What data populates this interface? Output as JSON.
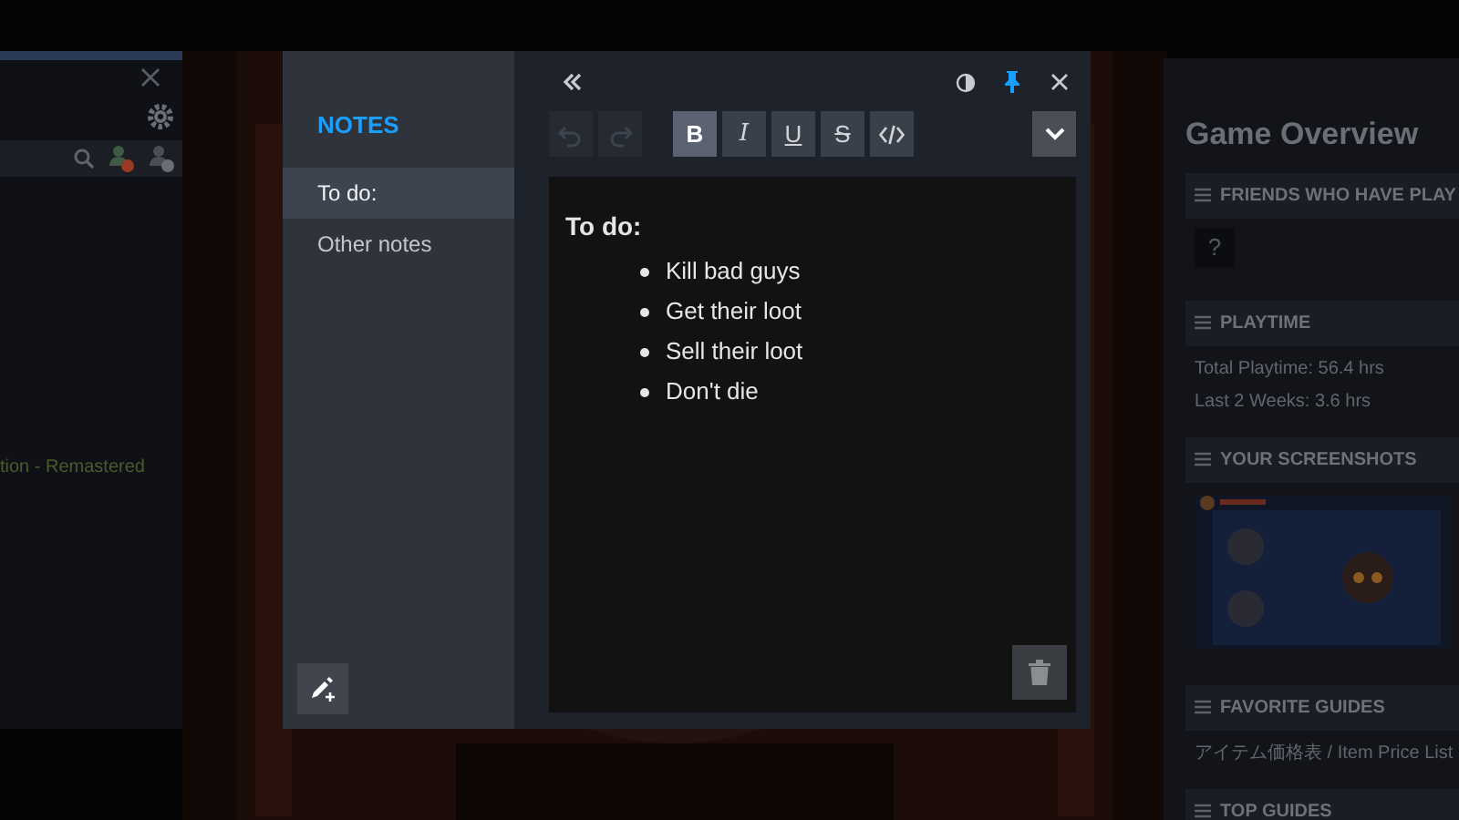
{
  "friends_panel": {
    "game_status": "tion - Remastered"
  },
  "notes": {
    "title": "NOTES",
    "items": [
      {
        "label": "To do:",
        "selected": true
      },
      {
        "label": "Other notes",
        "selected": false
      }
    ],
    "toolbar": [
      {
        "kind": "undo",
        "disabled": true
      },
      {
        "kind": "redo",
        "disabled": true
      },
      {
        "kind": "bold",
        "active": true,
        "label": "B"
      },
      {
        "kind": "italic",
        "active": false,
        "label": "I"
      },
      {
        "kind": "underline",
        "active": false,
        "label": "U"
      },
      {
        "kind": "strike",
        "active": false,
        "label": "S"
      },
      {
        "kind": "code",
        "active": false
      }
    ],
    "document": {
      "heading": "To do:",
      "bullets": [
        "Kill bad guys",
        "Get their loot",
        "Sell their loot",
        "Don't die"
      ]
    }
  },
  "game_overview": {
    "title": "Game Overview",
    "sections": [
      {
        "kind": "friends",
        "title": "FRIENDS WHO HAVE PLAY",
        "lines": [
          "?"
        ]
      },
      {
        "kind": "text",
        "title": "PLAYTIME",
        "lines": [
          "Total Playtime: 56.4 hrs",
          "Last 2 Weeks: 3.6 hrs"
        ]
      },
      {
        "kind": "screenshot",
        "title": "YOUR SCREENSHOTS"
      },
      {
        "kind": "text",
        "title": "FAVORITE GUIDES",
        "lines": [
          "アイテム価格表 / Item Price List"
        ]
      },
      {
        "kind": "text",
        "title": "TOP GUIDES"
      }
    ]
  }
}
